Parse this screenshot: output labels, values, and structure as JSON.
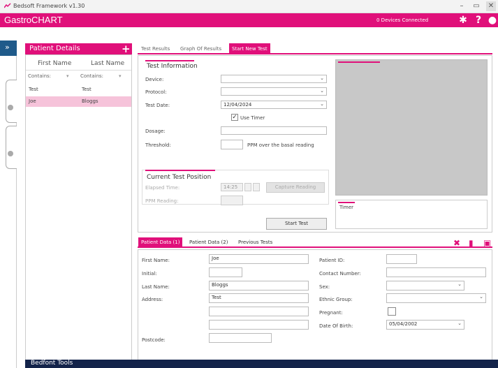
{
  "window": {
    "title": "Bedsoft Framework v1.30"
  },
  "header": {
    "brand": "GastroCHART",
    "devices_status": "0 Devices Connected"
  },
  "patient_panel": {
    "title": "Patient Details",
    "columns": [
      "First Name",
      "Last Name"
    ],
    "filter_labels": [
      "Contains:",
      "Contains:"
    ],
    "rows": [
      {
        "first": "Test",
        "last": "Test"
      },
      {
        "first": "Joe",
        "last": "Bloggs"
      }
    ]
  },
  "main_tabs": [
    "Test Results",
    "Graph Of Results",
    "Start New Test"
  ],
  "test_info": {
    "title": "Test Information",
    "device_label": "Device:",
    "protocol_label": "Protocol:",
    "test_date_label": "Test Date:",
    "test_date_value": "12/04/2024",
    "use_timer_label": "Use Timer",
    "dosage_label": "Dosage:",
    "threshold_label": "Threshold:",
    "threshold_suffix": "PPM over the basal reading"
  },
  "current_position": {
    "title": "Current Test Position",
    "elapsed_label": "Elapsed Time:",
    "elapsed_value": "14:25",
    "capture_button": "Capture Reading",
    "ppm_label": "PPM Reading:"
  },
  "start_button": "Start Test",
  "timer_label": "Timer",
  "bottom_tabs": [
    "Patient Data (1)",
    "Patient Data (2)",
    "Previous Tests"
  ],
  "patient_data": {
    "first_name_label": "First Name:",
    "first_name_value": "Joe",
    "initial_label": "Initial:",
    "last_name_label": "Last Name:",
    "last_name_value": "Bloggs",
    "address_label": "Address:",
    "address_value": "Test",
    "postcode_label": "Postcode:",
    "patient_id_label": "Patient ID:",
    "contact_label": "Contact Number:",
    "sex_label": "Sex:",
    "ethnic_label": "Ethnic Group:",
    "pregnant_label": "Pregnant:",
    "dob_label": "Date Of Birth:",
    "dob_value": "05/04/2002"
  },
  "footer": {
    "title": "Bedfont Tools"
  },
  "colors": {
    "accent": "#e0107a",
    "footer": "#13234a",
    "selected_row": "#f6c3da"
  }
}
